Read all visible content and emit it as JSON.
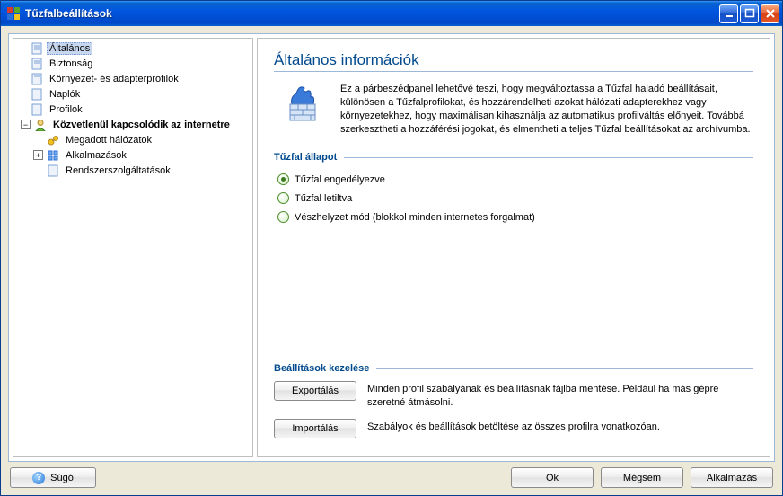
{
  "window": {
    "title": "Tűzfalbeállítások"
  },
  "sidebar": {
    "items": [
      {
        "label": "Általános",
        "selected": true
      },
      {
        "label": "Biztonság"
      },
      {
        "label": "Környezet- és adapterprofilok"
      },
      {
        "label": "Naplók"
      },
      {
        "label": "Profilok"
      },
      {
        "label": "Közvetlenül kapcsolódik az internetre",
        "bold": true,
        "expanded": true
      },
      {
        "label": "Megadott hálózatok"
      },
      {
        "label": "Alkalmazások",
        "expandable": true
      },
      {
        "label": "Rendszerszolgáltatások"
      }
    ]
  },
  "content": {
    "title": "Általános információk",
    "intro": "Ez a párbeszédpanel lehetővé teszi, hogy megváltoztassa a Tűzfal haladó beállításait, különösen a Tűzfalprofilokat, és hozzárendelheti azokat hálózati adapterekhez vagy környezetekhez, hogy maximálisan kihasználja az automatikus profilváltás előnyeit. Továbbá szerkesztheti a hozzáférési jogokat, és elmentheti a teljes Tűzfal beállításokat az archívumba.",
    "firewall_state": {
      "title": "Tűzfal állapot",
      "options": [
        {
          "label": "Tűzfal engedélyezve",
          "checked": true
        },
        {
          "label": "Tűzfal letiltva",
          "checked": false
        },
        {
          "label": "Vészhelyzet mód (blokkol minden internetes forgalmat)",
          "checked": false
        }
      ]
    },
    "settings_mgmt": {
      "title": "Beállítások kezelése",
      "export_btn": "Exportálás",
      "export_desc": "Minden profil szabályának és beállításnak fájlba mentése. Például ha más gépre szeretné átmásolni.",
      "import_btn": "Importálás",
      "import_desc": "Szabályok és beállítások betöltése az összes profilra vonatkozóan."
    }
  },
  "footer": {
    "help": "Súgó",
    "ok": "Ok",
    "cancel": "Mégsem",
    "apply": "Alkalmazás"
  }
}
